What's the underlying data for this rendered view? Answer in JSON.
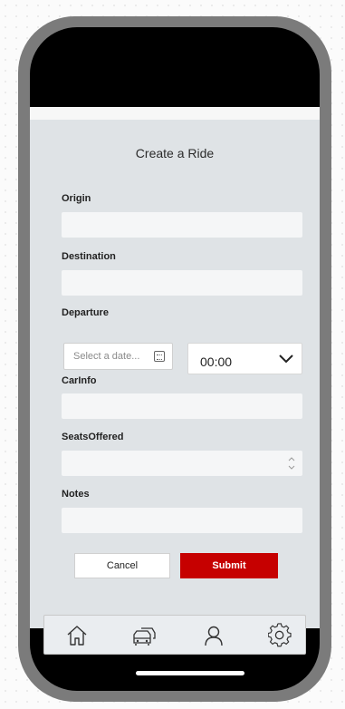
{
  "form": {
    "title": "Create a Ride",
    "origin_label": "Origin",
    "origin_value": "",
    "destination_label": "Destination",
    "destination_value": "",
    "departure_label": "Departure",
    "date_placeholder": "Select a date...",
    "time_value": "00:00",
    "carinfo_label": "CarInfo",
    "carinfo_value": "",
    "seats_label": "SeatsOffered",
    "seats_value": "",
    "notes_label": "Notes",
    "notes_value": ""
  },
  "actions": {
    "cancel_label": "Cancel",
    "submit_label": "Submit"
  },
  "nav": {
    "items": [
      {
        "icon": "home-icon"
      },
      {
        "icon": "cars-icon"
      },
      {
        "icon": "person-icon"
      },
      {
        "icon": "gear-icon"
      }
    ]
  },
  "colors": {
    "accent": "#c60000",
    "screen_bg": "#dfe3e6",
    "frame": "#7b7b7b"
  }
}
